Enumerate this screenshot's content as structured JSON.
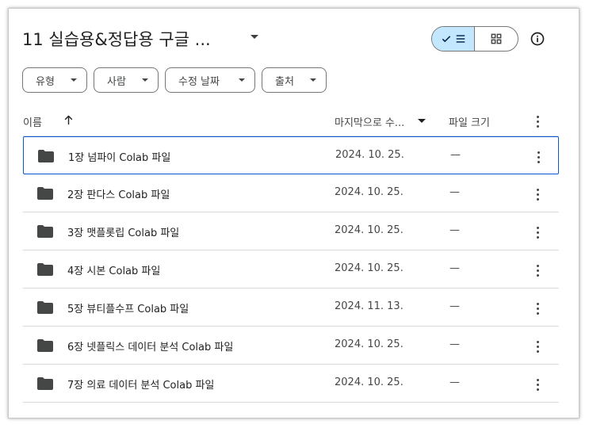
{
  "title": "11 실습용&정답용 구글 ...",
  "filters": [
    {
      "label": "유형"
    },
    {
      "label": "사람"
    },
    {
      "label": "수정 날짜"
    },
    {
      "label": "출처"
    }
  ],
  "columns": {
    "name": "이름",
    "modified": "마지막으로 수...",
    "size": "파일 크기"
  },
  "rows": [
    {
      "name": "1장 넘파이 Colab 파일",
      "date": "2024. 10. 25.",
      "size": "—"
    },
    {
      "name": "2장 판다스 Colab 파일",
      "date": "2024. 10. 25.",
      "size": "—"
    },
    {
      "name": "3장 맷플롯립 Colab 파일",
      "date": "2024. 10. 25.",
      "size": "—"
    },
    {
      "name": "4장 시본 Colab 파일",
      "date": "2024. 10. 25.",
      "size": "—"
    },
    {
      "name": "5장 뷰티플수프 Colab 파일",
      "date": "2024. 11. 13.",
      "size": "—"
    },
    {
      "name": "6장 넷플릭스 데이터 분석 Colab 파일",
      "date": "2024. 10. 25.",
      "size": "—"
    },
    {
      "name": "7장 의료 데이터 분석 Colab 파일",
      "date": "2024. 10. 25.",
      "size": "—"
    }
  ],
  "icons": {
    "folder": "folder-icon",
    "sort": "arrow-up-icon",
    "view_list": "list-view-icon",
    "view_grid": "grid-view-icon",
    "info": "info-icon",
    "more": "more-vert-icon"
  },
  "colors": {
    "selected_toggle": "#c2e7ff",
    "selected_row_border": "#0b57d0",
    "folder": "#444746"
  }
}
